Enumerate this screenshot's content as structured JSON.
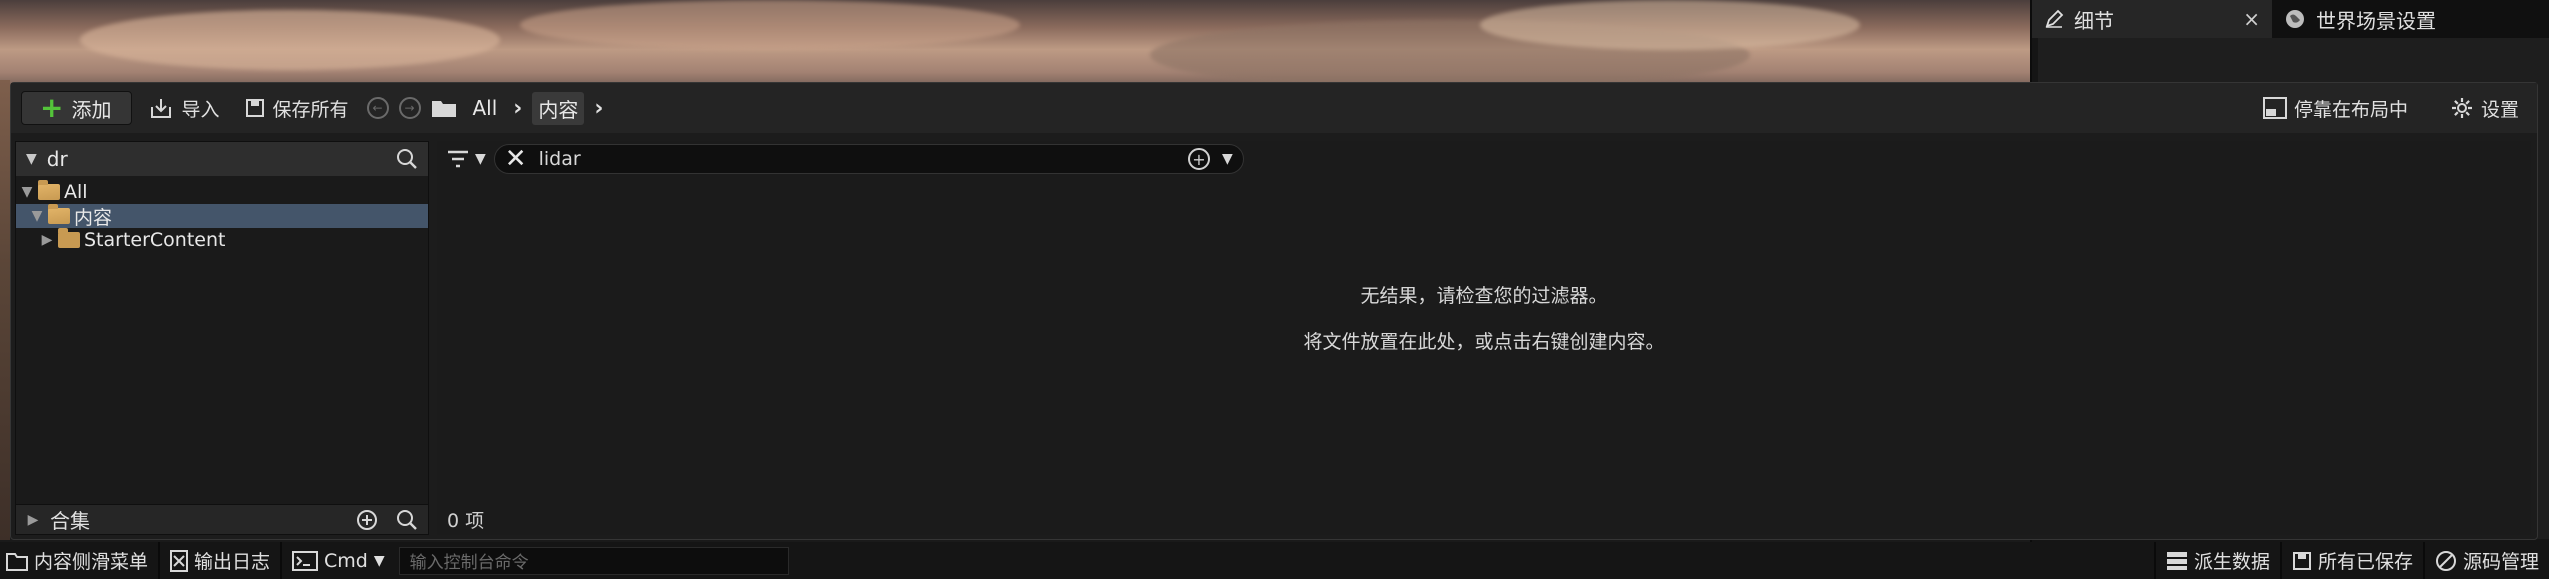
{
  "details_panel": {
    "tab_details": "细节",
    "tab_close": "×",
    "tab_world_settings": "世界场景设置"
  },
  "toolbar": {
    "add_label": "添加",
    "import_label": "导入",
    "save_all_label": "保存所有",
    "breadcrumbs": [
      "All",
      "内容"
    ],
    "dock_label": "停靠在布局中",
    "settings_label": "设置"
  },
  "sources": {
    "search_value": "dr",
    "tree": [
      {
        "label": "All",
        "expanded": true,
        "selected": false
      },
      {
        "label": "内容",
        "expanded": true,
        "selected": true
      },
      {
        "label": "StarterContent",
        "expanded": false,
        "selected": false
      }
    ],
    "collections_label": "合集"
  },
  "assets": {
    "search_value": "lidar",
    "empty_line1": "无结果，请检查您的过滤器。",
    "empty_line2": "将文件放置在此处，或点击右键创建内容。",
    "item_count": "0 项"
  },
  "statusbar": {
    "content_drawer": "内容侧滑菜单",
    "output_log": "输出日志",
    "cmd_label": "Cmd",
    "console_placeholder": "输入控制台命令",
    "derived_data": "派生数据",
    "all_saved": "所有已保存",
    "source_control": "源码管理"
  },
  "colors": {
    "accent_green": "#54c33a",
    "folder": "#c89a52",
    "selection": "#44556a"
  }
}
